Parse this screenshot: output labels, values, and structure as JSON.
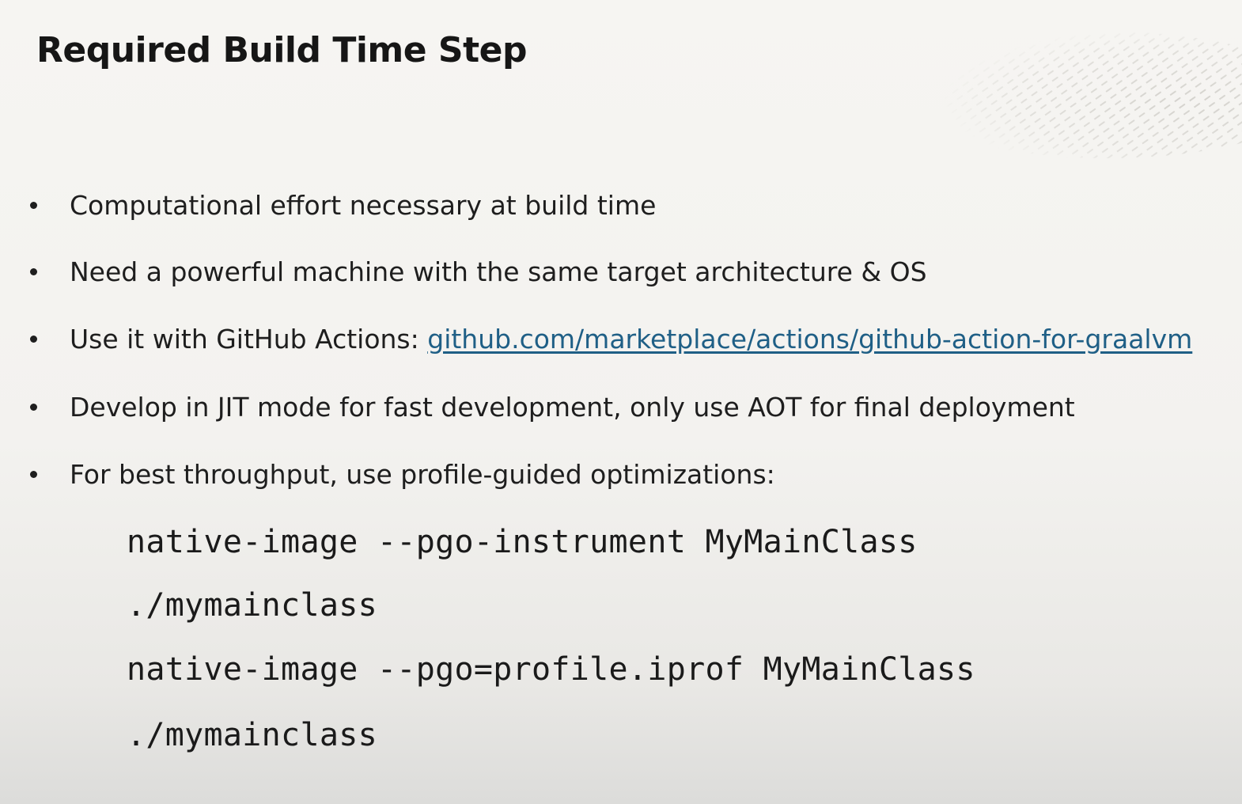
{
  "slide": {
    "title": "Required Build Time Step",
    "bullets": [
      {
        "text": "Computational effort necessary at build time"
      },
      {
        "text": "Need a powerful machine with the same target architecture & OS"
      },
      {
        "text": "Use it with GitHub Actions: ",
        "link": "github.com/marketplace/actions/github-action-for-graalvm"
      },
      {
        "text": "Develop in JIT mode for fast development, only use AOT for final deployment"
      },
      {
        "text": "For best throughput, use profile-guided optimizations:"
      }
    ],
    "code_lines": [
      "native-image --pgo-instrument MyMainClass",
      "./mymainclass",
      "native-image --pgo=profile.iprof MyMainClass",
      "./mymainclass"
    ]
  },
  "colors": {
    "link": "#1f5f86",
    "text": "#1e1e1e",
    "background": "#f5f4f1"
  }
}
